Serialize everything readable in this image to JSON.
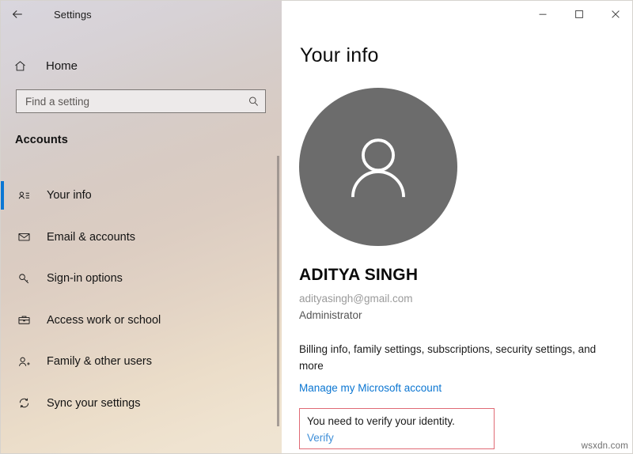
{
  "titlebar": {
    "back_icon": "back-arrow-icon",
    "app_title": "Settings",
    "minimize_label": "Minimize",
    "maximize_label": "Maximize",
    "close_label": "Close"
  },
  "sidebar": {
    "home_label": "Home",
    "home_icon": "home-icon",
    "search": {
      "placeholder": "Find a setting",
      "value": "",
      "icon": "search-icon"
    },
    "section_heading": "Accounts",
    "items": [
      {
        "label": "Your info",
        "icon": "contact-card-icon",
        "selected": true
      },
      {
        "label": "Email & accounts",
        "icon": "envelope-icon",
        "selected": false
      },
      {
        "label": "Sign-in options",
        "icon": "key-icon",
        "selected": false
      },
      {
        "label": "Access work or school",
        "icon": "briefcase-icon",
        "selected": false
      },
      {
        "label": "Family & other users",
        "icon": "person-add-icon",
        "selected": false
      },
      {
        "label": "Sync your settings",
        "icon": "sync-icon",
        "selected": false
      }
    ]
  },
  "main": {
    "page_title": "Your info",
    "avatar_icon": "person-avatar-icon",
    "user_name": "ADITYA SINGH",
    "user_email": "adityasingh@gmail.com",
    "user_role": "Administrator",
    "billing_text": "Billing info, family settings, subscriptions, security settings, and more",
    "manage_link": "Manage my Microsoft account",
    "verify": {
      "message": "You need to verify your identity.",
      "link": "Verify"
    }
  },
  "watermark": "wsxdn.com",
  "colors": {
    "accent_blue": "#0b77d4",
    "link_blue": "#0b76d2",
    "verify_link_blue": "#3f8fd8",
    "highlight_red": "#e06a75",
    "avatar_gray": "#6c6c6c"
  }
}
